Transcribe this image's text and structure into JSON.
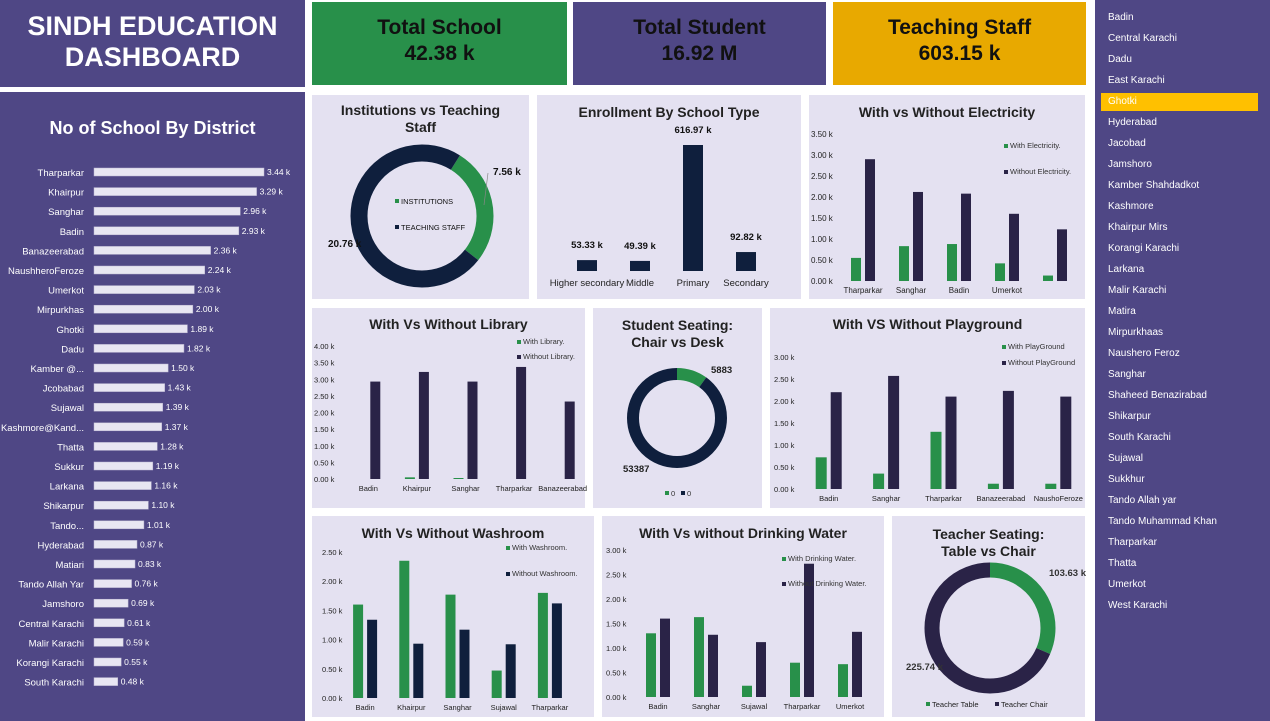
{
  "header": {
    "title_line1": "SINDH EDUCATION",
    "title_line2": "DASHBOARD"
  },
  "kpis": [
    {
      "label": "Total School",
      "value": "42.38 k",
      "color": "#28904a"
    },
    {
      "label": "Total Student",
      "value": "16.92 M",
      "color": "#4f4785"
    },
    {
      "label": "Teaching Staff",
      "value": "603.15 k",
      "color": "#e8a900"
    }
  ],
  "districts_chart": {
    "title": "No of School By District",
    "rows": [
      {
        "name": "Tharparkar",
        "value": 3.44,
        "label": "3.44 k"
      },
      {
        "name": "Khairpur",
        "value": 3.29,
        "label": "3.29 k"
      },
      {
        "name": "Sanghar",
        "value": 2.96,
        "label": "2.96 k"
      },
      {
        "name": "Badin",
        "value": 2.93,
        "label": "2.93 k"
      },
      {
        "name": "Banazeerabad",
        "value": 2.36,
        "label": "2.36 k"
      },
      {
        "name": "NaushheroFeroze",
        "value": 2.24,
        "label": "2.24 k"
      },
      {
        "name": "Umerkot",
        "value": 2.03,
        "label": "2.03 k"
      },
      {
        "name": "Mirpurkhas",
        "value": 2.0,
        "label": "2.00 k"
      },
      {
        "name": "Ghotki",
        "value": 1.89,
        "label": "1.89 k"
      },
      {
        "name": "Dadu",
        "value": 1.82,
        "label": "1.82 k"
      },
      {
        "name": "Kamber @...",
        "value": 1.5,
        "label": "1.50 k"
      },
      {
        "name": "Jcobabad",
        "value": 1.43,
        "label": "1.43 k"
      },
      {
        "name": "Sujawal",
        "value": 1.39,
        "label": "1.39 k"
      },
      {
        "name": "Kashmore@Kand...",
        "value": 1.37,
        "label": "1.37 k"
      },
      {
        "name": "Thatta",
        "value": 1.28,
        "label": "1.28 k"
      },
      {
        "name": "Sukkur",
        "value": 1.19,
        "label": "1.19 k"
      },
      {
        "name": "Larkana",
        "value": 1.16,
        "label": "1.16 k"
      },
      {
        "name": "Shikarpur",
        "value": 1.1,
        "label": "1.10 k"
      },
      {
        "name": "Tando...",
        "value": 1.01,
        "label": "1.01 k"
      },
      {
        "name": "Hyderabad",
        "value": 0.87,
        "label": "0.87 k"
      },
      {
        "name": "Matiari",
        "value": 0.83,
        "label": "0.83 k"
      },
      {
        "name": "Tando Allah Yar",
        "value": 0.76,
        "label": "0.76 k"
      },
      {
        "name": "Jamshoro",
        "value": 0.69,
        "label": "0.69 k"
      },
      {
        "name": "Central Karachi",
        "value": 0.61,
        "label": "0.61 k"
      },
      {
        "name": "Malir Karachi",
        "value": 0.59,
        "label": "0.59 k"
      },
      {
        "name": "Korangi Karachi",
        "value": 0.55,
        "label": "0.55 k"
      },
      {
        "name": "South  Karachi",
        "value": 0.48,
        "label": "0.48 k"
      }
    ]
  },
  "institutions_donut": {
    "title_line1": "Institutions vs Teaching",
    "title_line2": "Staff",
    "slices": [
      {
        "name": "INSTITUTIONS",
        "value": 7.56,
        "label": "7.56 k",
        "color": "#28904a"
      },
      {
        "name": "TEACHING STAFF",
        "value": 20.76,
        "label": "20.76 k",
        "color": "#0f1f3d"
      }
    ]
  },
  "enrollment": {
    "title": "Enrollment By School Type",
    "categories": [
      "Higher secondary",
      "Middle",
      "Primary",
      "Secondary"
    ],
    "values": [
      53.33,
      49.39,
      616.97,
      92.82
    ],
    "labels": [
      "53.33 k",
      "49.39 k",
      "616.97 k",
      "92.82 k"
    ]
  },
  "electricity": {
    "title": "With vs Without Electricity",
    "ticks": [
      "3.50 k",
      "3.00 k",
      "2.50 k",
      "2.00 k",
      "1.50 k",
      "1.00 k",
      "0.50 k",
      "0.00 k"
    ],
    "categories": [
      "Tharparkar",
      "Sanghar",
      "Badin",
      "Umerkot",
      ""
    ],
    "series": [
      {
        "name": "With Electricity.",
        "values": [
          0.55,
          0.83,
          0.88,
          0.42,
          0.13
        ]
      },
      {
        "name": "Without Electricity.",
        "values": [
          2.9,
          2.12,
          2.08,
          1.6,
          1.23
        ]
      }
    ]
  },
  "library": {
    "title": "With Vs Without Library",
    "ticks": [
      "4.00 k",
      "3.50 k",
      "3.00 k",
      "2.50 k",
      "2.00 k",
      "1.50 k",
      "1.00 k",
      "0.50 k",
      "0.00 k"
    ],
    "categories": [
      "Badin",
      "Khairpur",
      "Sanghar",
      "Tharparkar",
      "Banazeerabad"
    ],
    "series": [
      {
        "name": "With Library.",
        "values": [
          0,
          0.05,
          0.03,
          0,
          0
        ]
      },
      {
        "name": "Without Library.",
        "values": [
          2.93,
          3.22,
          2.93,
          3.37,
          2.33
        ]
      }
    ]
  },
  "student_seating": {
    "title_line1": "Student Seating:",
    "title_line2": "Chair vs Desk",
    "slices": [
      {
        "name": "0",
        "value": 5883,
        "label": "5883",
        "color": "#28904a"
      },
      {
        "name": "0",
        "value": 53387,
        "label": "53387",
        "color": "#0f1f3d"
      }
    ]
  },
  "playground": {
    "title": "With VS Without Playground",
    "ticks": [
      "3.00 k",
      "2.50 k",
      "2.00 k",
      "1.50 k",
      "1.00 k",
      "0.50 k",
      "0.00 k"
    ],
    "categories": [
      "Badin",
      "Sanghar",
      "Tharparkar",
      "Banazeerabad",
      "NaushoFeroze"
    ],
    "series": [
      {
        "name": "With PlayGround",
        "values": [
          0.72,
          0.35,
          1.3,
          0.12,
          0.12
        ]
      },
      {
        "name": "Without PlayGround",
        "values": [
          2.2,
          2.57,
          2.1,
          2.23,
          2.1
        ]
      }
    ]
  },
  "washroom": {
    "title": "With Vs Without Washroom",
    "ticks": [
      "2.50 k",
      "2.00 k",
      "1.50 k",
      "1.00 k",
      "0.50 k",
      "0.00 k"
    ],
    "categories": [
      "Badin",
      "Khairpur",
      "Sanghar",
      "Sujawal",
      "Tharparkar"
    ],
    "series": [
      {
        "name": "With Washroom.",
        "values": [
          1.6,
          2.35,
          1.77,
          0.47,
          1.8
        ]
      },
      {
        "name": "Without Washroom.",
        "values": [
          1.34,
          0.93,
          1.17,
          0.92,
          1.62
        ]
      }
    ]
  },
  "drinking_water": {
    "title": "With Vs without Drinking Water",
    "ticks": [
      "3.00 k",
      "2.50 k",
      "2.00 k",
      "1.50 k",
      "1.00 k",
      "0.50 k",
      "0.00 k"
    ],
    "categories": [
      "Badin",
      "Sanghar",
      "Sujawal",
      "Tharparkar",
      "Umerkot"
    ],
    "series": [
      {
        "name": "With Drinking Water.",
        "values": [
          1.3,
          1.63,
          0.23,
          0.7,
          0.67
        ]
      },
      {
        "name": "Without Drinking Water.",
        "values": [
          1.6,
          1.27,
          1.12,
          2.72,
          1.33
        ]
      }
    ]
  },
  "teacher_seating": {
    "title_line1": "Teacher Seating:",
    "title_line2": "Table vs Chair",
    "slices": [
      {
        "name": "Teacher Table",
        "value": 103.63,
        "label": "103.63 k",
        "color": "#28904a"
      },
      {
        "name": "Teacher Chair",
        "value": 225.74,
        "label": "225.74 k",
        "color": "#2a2347"
      }
    ]
  },
  "slicer": {
    "selected": "Ghotki",
    "items": [
      "Badin",
      "Central Karachi",
      "Dadu",
      "East Karachi",
      "Ghotki",
      "Hyderabad",
      "Jacobad",
      "Jamshoro",
      "Kamber Shahdadkot",
      "Kashmore",
      "Khairpur Mirs",
      "Korangi Karachi",
      "Larkana",
      "Malir Karachi",
      "Matira",
      "Mirpurkhaas",
      "Naushero Feroz",
      "Sanghar",
      "Shaheed Benazirabad",
      "Shikarpur",
      "South Karachi",
      "Sujawal",
      "Sukkhur",
      "Tando Allah yar",
      "Tando Muhammad Khan",
      "Tharparkar",
      "Thatta",
      "Umerkot",
      "West Karachi"
    ]
  }
}
